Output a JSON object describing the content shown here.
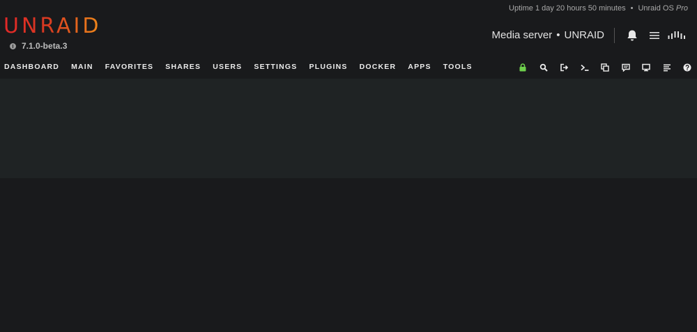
{
  "header": {
    "uptime": "Uptime 1 day 20 hours 50 minutes",
    "separator": "•",
    "os_name": "Unraid OS",
    "os_edition": "Pro",
    "logo_text": "UNRAID",
    "version": "7.1.0-beta.3",
    "server_description": "Media server",
    "server_separator": "•",
    "server_name": "UNRAID"
  },
  "nav": {
    "items": [
      {
        "label": "DASHBOARD"
      },
      {
        "label": "MAIN"
      },
      {
        "label": "FAVORITES"
      },
      {
        "label": "SHARES"
      },
      {
        "label": "USERS"
      },
      {
        "label": "SETTINGS"
      },
      {
        "label": "PLUGINS"
      },
      {
        "label": "DOCKER"
      },
      {
        "label": "APPS"
      },
      {
        "label": "TOOLS"
      }
    ],
    "icons": [
      "lock-icon",
      "search-icon",
      "logout-icon",
      "terminal-icon",
      "copy-icon",
      "feedback-icon",
      "monitor-icon",
      "log-icon",
      "help-icon"
    ]
  },
  "colors": {
    "background": "#191a1c",
    "content_band": "#1f2324",
    "lock_green": "#6ed04c",
    "logo_start": "#e22828",
    "logo_end": "#ee8a1a"
  }
}
